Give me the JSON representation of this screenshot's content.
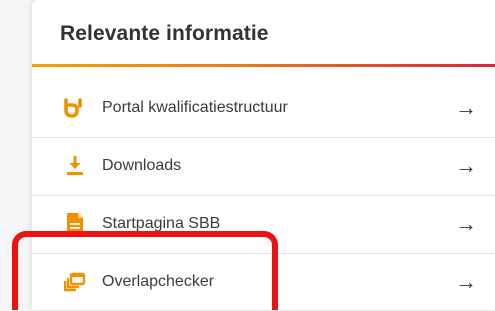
{
  "panel": {
    "title": "Relevante informatie"
  },
  "links": [
    {
      "label": "Portal kwalificatiestructuur",
      "icon": "sbb-logo-icon",
      "arrow": "→"
    },
    {
      "label": "Downloads",
      "icon": "download-icon",
      "arrow": "→"
    },
    {
      "label": "Startpagina SBB",
      "icon": "document-icon",
      "arrow": "→"
    },
    {
      "label": "Overlapchecker",
      "icon": "overlap-windows-icon",
      "arrow": "→"
    }
  ],
  "colors": {
    "accent_orange": "#f29100",
    "accent_red": "#d7263d",
    "highlight_red": "#ee1111"
  }
}
